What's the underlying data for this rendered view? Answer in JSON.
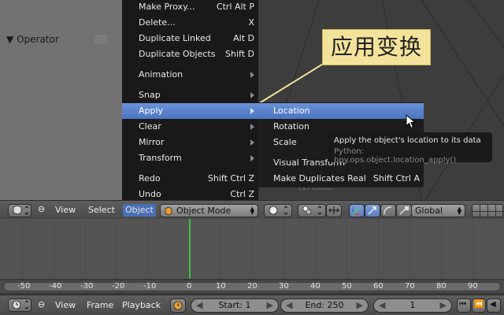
{
  "left_panel": {
    "operator_label": "Operator"
  },
  "viewport": {
    "object_label": "(1) Cube"
  },
  "annotation": {
    "text": "应用变换"
  },
  "main_menu": {
    "items": [
      {
        "label": "Make Proxy...",
        "shortcut": "Ctrl Alt P",
        "submenu": false
      },
      {
        "label": "Delete...",
        "shortcut": "X",
        "submenu": false
      },
      {
        "label": "Duplicate Linked",
        "shortcut": "Alt D",
        "submenu": false
      },
      {
        "label": "Duplicate Objects",
        "shortcut": "Shift D",
        "submenu": false
      },
      {
        "label": "Animation",
        "shortcut": "",
        "submenu": true
      },
      {
        "label": "Snap",
        "shortcut": "",
        "submenu": true
      },
      {
        "label": "Apply",
        "shortcut": "",
        "submenu": true,
        "active": true
      },
      {
        "label": "Clear",
        "shortcut": "",
        "submenu": true
      },
      {
        "label": "Mirror",
        "shortcut": "",
        "submenu": true
      },
      {
        "label": "Transform",
        "shortcut": "",
        "submenu": true
      },
      {
        "label": "Redo",
        "shortcut": "Shift Ctrl Z",
        "submenu": false
      },
      {
        "label": "Undo",
        "shortcut": "Ctrl Z",
        "submenu": false
      }
    ]
  },
  "sub_menu": {
    "items": [
      {
        "label": "Location",
        "shortcut": "",
        "active": true
      },
      {
        "label": "Rotation",
        "shortcut": ""
      },
      {
        "label": "Scale",
        "shortcut": ""
      },
      {
        "label": "Visual Transform",
        "shortcut": ""
      },
      {
        "label": "Make Duplicates Real",
        "shortcut": "Shift Ctrl A"
      }
    ]
  },
  "tooltip": {
    "description": "Apply the object's location to its data",
    "python": "Python: bpy.ops.object.location_apply()"
  },
  "view_header": {
    "view": "View",
    "select": "Select",
    "object": "Object",
    "mode": "Object Mode",
    "orientation": "Global"
  },
  "ruler": {
    "ticks": [
      "-50",
      "-40",
      "-30",
      "-20",
      "-10",
      "0",
      "10",
      "20",
      "30",
      "40",
      "50",
      "60",
      "70",
      "80",
      "90"
    ]
  },
  "timeline_header": {
    "view": "View",
    "frame": "Frame",
    "playback": "Playback",
    "start": "Start: 1",
    "end": "End: 250",
    "current": "1"
  },
  "colors": {
    "menu_bg": "#191919",
    "highlight": "#5680c2",
    "playhead": "#39c13d",
    "annotation_bg": "#f3e39a"
  }
}
